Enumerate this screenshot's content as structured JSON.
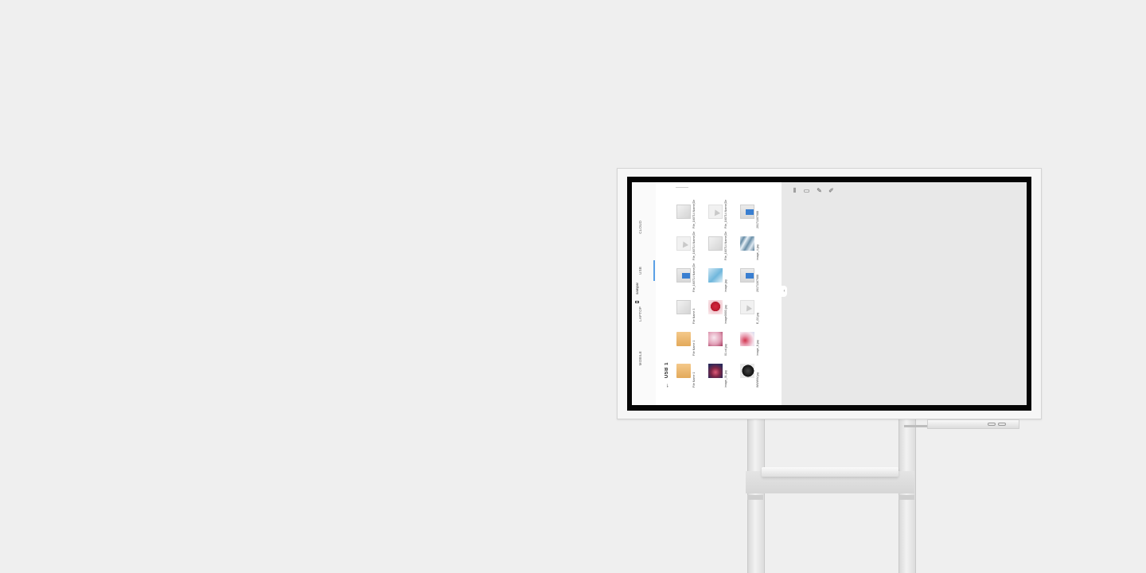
{
  "rail": {
    "tabs": [
      {
        "label": "MOBILE"
      },
      {
        "label": "LAPTOP"
      },
      {
        "label": "USB"
      },
      {
        "label": "CLOUD"
      }
    ],
    "device": {
      "label": "sampar",
      "icon": "device-icon"
    }
  },
  "browser": {
    "header": "USB 1",
    "back_icon": "back-arrow-icon",
    "columns": [
      [
        {
          "label": "File Name 1",
          "kind": "folder"
        },
        {
          "label": "File Name 1",
          "kind": "folder"
        },
        {
          "label": "File Name 3",
          "kind": "document"
        },
        {
          "label": "File_160714 Name(Default)",
          "kind": "document-blue"
        },
        {
          "label": "File_160714 Name(Default)",
          "kind": "image-placeholder"
        },
        {
          "label": "File_160714 Name(Default)",
          "kind": "document"
        }
      ],
      [
        {
          "label": "image_01.jpg",
          "kind": "flower"
        },
        {
          "label": "01.cd.jpg",
          "kind": "rose"
        },
        {
          "label": "image0003.jpg",
          "kind": "pink"
        },
        {
          "label": "image.jpg",
          "kind": "blue-roll"
        },
        {
          "label": "File_160714 Name(Default)",
          "kind": "document"
        },
        {
          "label": "File_160714 Name(Default)",
          "kind": "image-placeholder"
        }
      ],
      [
        {
          "label": "WWWW.jpg",
          "kind": "dark"
        },
        {
          "label": "image_8.jpg",
          "kind": "lips"
        },
        {
          "label": "E_02.jpg",
          "kind": "image-placeholder"
        },
        {
          "label": "20171307088",
          "kind": "document-blue"
        },
        {
          "label": "image_4.jpg",
          "kind": "wave"
        },
        {
          "label": "20171307088",
          "kind": "document-blue"
        }
      ]
    ]
  },
  "toolbar": {
    "icons": [
      "grid-icon",
      "layout-icon",
      "pen-icon",
      "highlighter-icon"
    ]
  },
  "canvas": {
    "collapse_icon": "chevron-left-icon",
    "resize_icon": "resize-icon"
  },
  "colors": {
    "background": "#efefef",
    "bezel": "#050505",
    "accent": "#5aa0e6",
    "folder": "#e3a95a"
  }
}
